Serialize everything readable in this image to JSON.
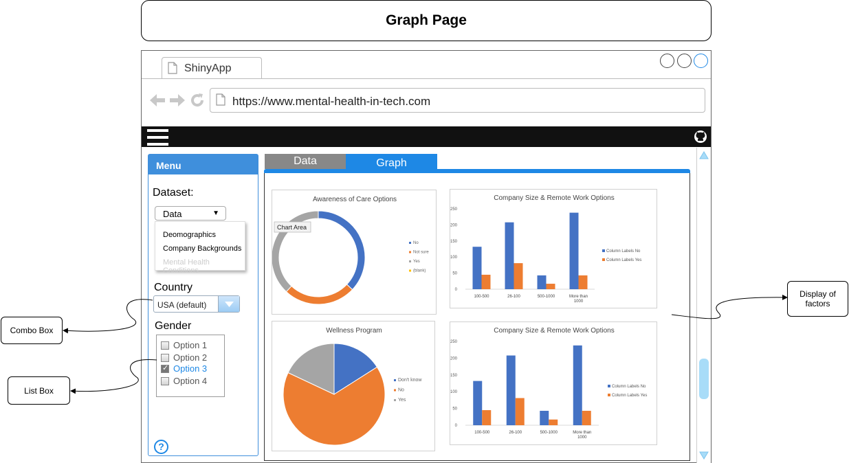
{
  "page_title": "Graph Page",
  "browser": {
    "tab_title": "ShinyApp",
    "url": "https://www.mental-health-in-tech.com"
  },
  "sidebar": {
    "title": "Menu",
    "dataset": {
      "label": "Dataset:",
      "selected": "Data",
      "options": [
        "Deomographics",
        "Company Backgrounds",
        "Mental Health Conditions"
      ]
    },
    "country": {
      "label": "Country",
      "selected": "USA (default)"
    },
    "gender": {
      "label": "Gender",
      "options": [
        {
          "label": "Option 1",
          "checked": false
        },
        {
          "label": "Option 2",
          "checked": false
        },
        {
          "label": "Option 3",
          "checked": true
        },
        {
          "label": "Option 4",
          "checked": false
        }
      ]
    }
  },
  "tabs": [
    {
      "label": "Data",
      "active": false
    },
    {
      "label": "Graph",
      "active": true
    }
  ],
  "annotations": {
    "combo_box": "Combo Box",
    "list_box": "List Box",
    "display_line1": "Display of",
    "display_line2": "factors"
  },
  "colors": {
    "blue": "#4472c4",
    "orange": "#ed7d31",
    "gray": "#a5a5a5",
    "yellow": "#ffc000",
    "accent": "#1e88e5"
  },
  "chart_data": [
    {
      "type": "pie",
      "donut": true,
      "title": "Awareness of Care Options",
      "tooltip": "Chart Area",
      "categories": [
        "No",
        "Not sure",
        "Yes",
        "(blank)"
      ],
      "values": [
        37,
        25,
        38,
        0
      ],
      "legend": "right"
    },
    {
      "type": "bar",
      "title": "Company Size & Remote Work Options",
      "categories": [
        "100-500",
        "26-100",
        "500-1000",
        "More than 1000"
      ],
      "series": [
        {
          "name": "Column Labels No",
          "values": [
            132,
            208,
            43,
            238
          ]
        },
        {
          "name": "Column Labels Yes",
          "values": [
            45,
            81,
            17,
            43
          ]
        }
      ],
      "yticks": [
        0,
        50,
        100,
        150,
        200,
        250
      ],
      "ylim": [
        0,
        250
      ],
      "legend": "right"
    },
    {
      "type": "pie",
      "title": "Wellness Program",
      "categories": [
        "Don't know",
        "No",
        "Yes"
      ],
      "values": [
        16,
        66,
        18
      ],
      "legend": "right"
    },
    {
      "type": "bar",
      "title": "Company Size & Remote Work Options",
      "categories": [
        "100-500",
        "26-100",
        "500-1000",
        "More than 1000"
      ],
      "series": [
        {
          "name": "Column Labels No",
          "values": [
            132,
            208,
            43,
            238
          ]
        },
        {
          "name": "Column Labels Yes",
          "values": [
            45,
            81,
            17,
            43
          ]
        }
      ],
      "yticks": [
        0,
        50,
        100,
        150,
        200,
        250
      ],
      "ylim": [
        0,
        250
      ],
      "legend": "right"
    }
  ]
}
